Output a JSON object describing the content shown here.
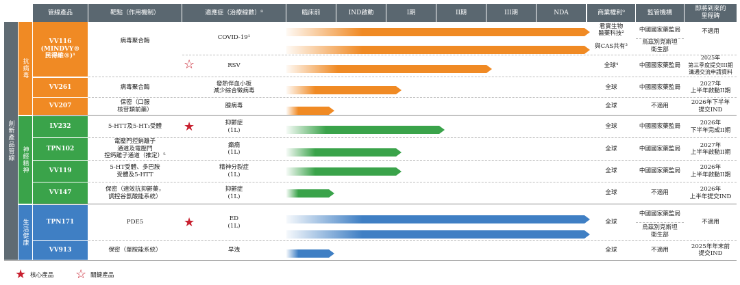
{
  "colors": {
    "orange": "#f08a24",
    "green": "#3aa34a",
    "blue": "#3f7fc4",
    "header": "#5a6770",
    "side": "#5f6b73",
    "star": "#c8202f"
  },
  "header": {
    "product": "管線產品",
    "target": "靶點（作用機制）",
    "indication": "適應症（治療線數）⁸",
    "preclinical": "臨床前",
    "ind": "IND啟動",
    "p1": "I期",
    "p2": "II期",
    "p3": "III期",
    "nda": "NDA",
    "rights": "商業權利⁹",
    "regulator": "監管機構",
    "milestone": "即將到來的\n里程碑"
  },
  "sidebar": {
    "main": "創新產品管線",
    "antiviral": "抗病毒",
    "neuro": "神經精神",
    "health": "生活健康"
  },
  "rows": [
    {
      "code": "VV116\n(MINDVY®\n民得維®)¹",
      "target": "病毒聚合酶",
      "indication": "COVID-19¹",
      "rights": "君實生物\n醫藥科技²",
      "regulator": "中國國家藥監局",
      "milestone": "不適用"
    },
    {
      "indication2": "",
      "rights": "與CAS共有³",
      "regulator": "烏茲別克斯坦\n衛生部"
    },
    {
      "indication": "RSV",
      "rights": "全球⁴",
      "regulator": "中國國家藥監局",
      "milestone": "2025年\n第三季度提交III期\n溝通交流申請資料"
    },
    {
      "code": "VV261",
      "target": "病毒聚合酶",
      "indication": "發熱伴血小板\n減少綜合徵病毒",
      "rights": "全球",
      "regulator": "中國國家藥監局",
      "milestone": "2027年\n上半年啟動II期"
    },
    {
      "code": "VV207",
      "target": "保密（口服\n核苷類前藥）",
      "indication": "腺病毒",
      "rights": "全球",
      "regulator": "不適用",
      "milestone": "2026年下半年\n提交IND"
    },
    {
      "code": "LV232",
      "target": "5-HTT及5-HT₃受體",
      "indication": "抑鬱症\n(1L)",
      "rights": "全球",
      "regulator": "中國國家藥監局",
      "milestone": "2026年\n下半年完成II期"
    },
    {
      "code": "TPN102",
      "target": "電壓門控鈉離子\n通道及電壓門\n控鈣離子通道（推定）⁵",
      "indication": "癲癇\n(1L)",
      "rights": "全球",
      "regulator": "中國國家藥監局",
      "milestone": "2027年\n上半年啟動II期"
    },
    {
      "code": "VV119",
      "target": "5-HT受體、多巴胺\n受體及5-HTT",
      "indication": "精神分裂症\n(1L)",
      "rights": "全球",
      "regulator": "中國國家藥監局",
      "milestone": "2026年\n上半年啟動II期"
    },
    {
      "code": "VV147",
      "target": "保密（速效抗抑鬱藥，\n調控谷氨酸能系統）",
      "indication": "抑鬱症\n(1L)",
      "rights": "全球",
      "regulator": "不適用",
      "milestone": "2026年\n上半年提交IND"
    },
    {
      "code": "TPN171",
      "target": "PDE5",
      "indication": "ED\n(1L)",
      "rights": "全球",
      "regulator": "中國國家藥監局",
      "regulator2": "烏茲別克斯坦\n衛生部",
      "milestone": "不適用"
    },
    {
      "code": "VV913",
      "target": "保密（單胺能系統）",
      "indication": "早洩",
      "rights": "全球",
      "regulator": "不適用",
      "milestone": "2025年年末前\n提交IND"
    }
  ],
  "progress": [
    {
      "group": "antiviral",
      "stage_end": "NDA+"
    },
    {
      "group": "antiviral",
      "stage_end": "NDA+"
    },
    {
      "group": "antiviral",
      "stage_end": "III期"
    },
    {
      "group": "antiviral",
      "stage_end": "I期"
    },
    {
      "group": "antiviral",
      "stage_end": "臨床前"
    },
    {
      "group": "neuro",
      "stage_end": "II期"
    },
    {
      "group": "neuro",
      "stage_end": "I期"
    },
    {
      "group": "neuro",
      "stage_end": "I期"
    },
    {
      "group": "neuro",
      "stage_end": "臨床前"
    },
    {
      "group": "health",
      "stage_end": "NDA+"
    },
    {
      "group": "health",
      "stage_end": "NDA+"
    },
    {
      "group": "health",
      "stage_end": "臨床前"
    }
  ],
  "legend": {
    "core": "核心產品",
    "key": "關鍵產品"
  }
}
